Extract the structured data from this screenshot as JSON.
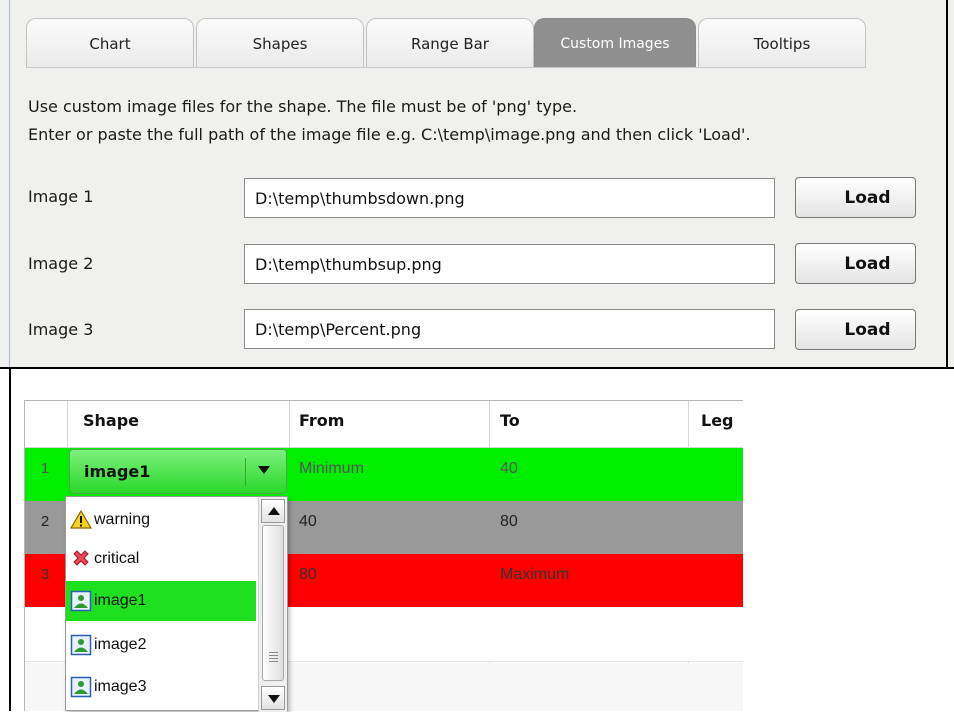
{
  "tabs": [
    "Chart",
    "Shapes",
    "Range Bar",
    "Custom Images",
    "Tooltips"
  ],
  "active_tab": "Custom Images",
  "description": {
    "line1": "Use custom image files for the shape. The file must be of 'png' type.",
    "line2": "Enter or paste the full path of the image file e.g.  C:\\temp\\image.png and then click 'Load'."
  },
  "images": [
    {
      "label": "Image 1",
      "path": "D:\\temp\\thumbsdown.png",
      "button": "Load"
    },
    {
      "label": "Image 2",
      "path": "D:\\temp\\thumbsup.png",
      "button": "Load"
    },
    {
      "label": "Image 3",
      "path": "D:\\temp\\Percent.png",
      "button": "Load"
    }
  ],
  "grid": {
    "headers": {
      "shape": "Shape",
      "from": "From",
      "to": "To",
      "legend": "Leg"
    },
    "rows": [
      {
        "num": "1",
        "from": "Minimum",
        "to": "40",
        "bg": "#00ee00",
        "color": "#555555"
      },
      {
        "num": "2",
        "from": "40",
        "to": "80",
        "bg": "#999999",
        "color": "#222222"
      },
      {
        "num": "3",
        "from": "80",
        "to": "Maximum",
        "bg": "#ff0000",
        "color": "#333333"
      }
    ]
  },
  "combo": {
    "value": "image1",
    "color": "#2bd82b"
  },
  "dropdown_options": [
    {
      "label": "warning",
      "icon": "warning-icon"
    },
    {
      "label": "critical",
      "icon": "critical-icon"
    },
    {
      "label": "image1",
      "icon": "image-icon",
      "selected": true
    },
    {
      "label": "image2",
      "icon": "image-icon"
    },
    {
      "label": "image3",
      "icon": "image-icon"
    }
  ]
}
